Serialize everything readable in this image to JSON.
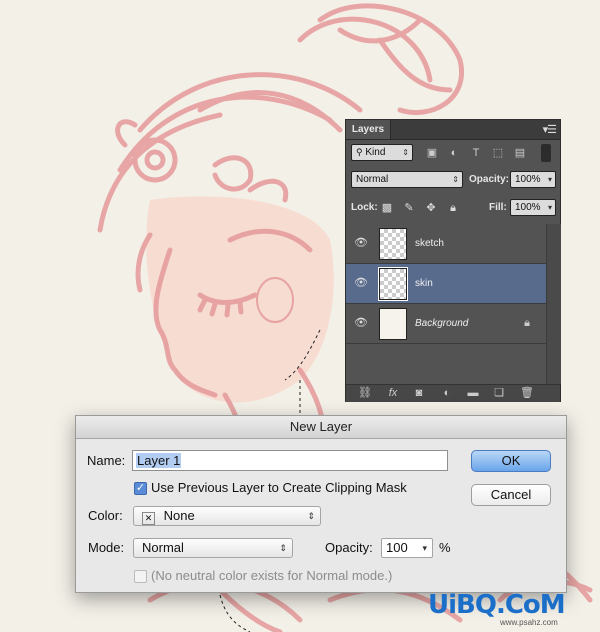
{
  "layers_panel": {
    "tab_label": "Layers",
    "menu_icon": "panel-menu-icon",
    "filter": {
      "label": "Kind"
    },
    "blend_mode": "Normal",
    "opacity_label": "Opacity:",
    "opacity_value": "100%",
    "lock_label": "Lock:",
    "fill_label": "Fill:",
    "fill_value": "100%",
    "layers": [
      {
        "name": "sketch"
      },
      {
        "name": "skin"
      },
      {
        "name": "Background"
      }
    ]
  },
  "dialog": {
    "title": "New Layer",
    "name_label": "Name:",
    "name_value": "Layer 1",
    "clipping_label": "Use Previous Layer to Create Clipping Mask",
    "color_label": "Color:",
    "color_value": "None",
    "mode_label": "Mode:",
    "mode_value": "Normal",
    "opacity_label": "Opacity:",
    "opacity_value": "100",
    "opacity_unit": "%",
    "neutral_label": "(No neutral color exists for Normal mode.)",
    "ok_label": "OK",
    "cancel_label": "Cancel"
  },
  "watermark": {
    "logo": "UiBQ.CoM",
    "url": "www.psahz.com"
  },
  "colors": {
    "sketch_line": "#e59a9a",
    "skin_fill": "#f7dcd2",
    "selected_layer": "#596b8d",
    "ok_button": "#6aa5ea"
  }
}
